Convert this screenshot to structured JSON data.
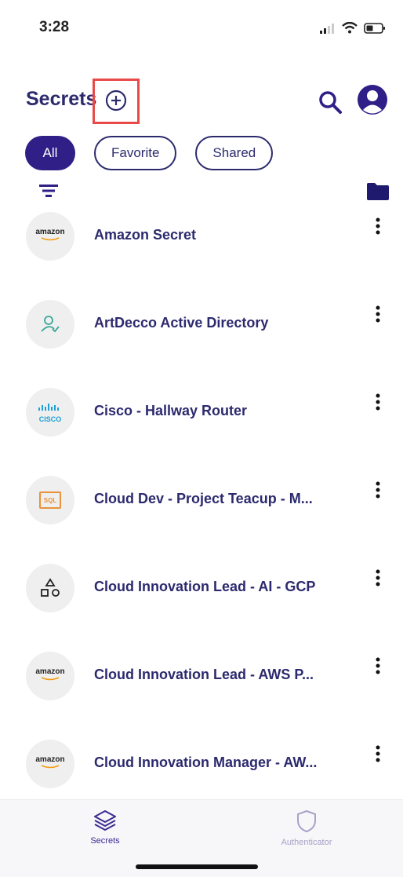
{
  "status": {
    "time": "3:28"
  },
  "header": {
    "title": "Secrets"
  },
  "filters": {
    "all": "All",
    "favorite": "Favorite",
    "shared": "Shared"
  },
  "secrets": [
    {
      "name": "Amazon Secret",
      "icon": "amazon-logo",
      "logo_text": "amazon"
    },
    {
      "name": "ArtDecco Active Directory",
      "icon": "user-check-icon"
    },
    {
      "name": "Cisco - Hallway Router",
      "icon": "cisco-logo",
      "logo_text": "CISCO"
    },
    {
      "name": "Cloud Dev - Project Teacup - M...",
      "icon": "sql-icon",
      "logo_text": "SQL"
    },
    {
      "name": "Cloud Innovation Lead - AI - GCP",
      "icon": "shapes-icon"
    },
    {
      "name": "Cloud Innovation Lead - AWS P...",
      "icon": "amazon-logo",
      "logo_text": "amazon"
    },
    {
      "name": "Cloud Innovation Manager - AW...",
      "icon": "amazon-logo",
      "logo_text": "amazon"
    }
  ],
  "nav": {
    "secrets": "Secrets",
    "authenticator": "Authenticator"
  },
  "colors": {
    "primary": "#2f1f86",
    "title": "#2c2a6e",
    "highlight": "#e84a4a"
  }
}
